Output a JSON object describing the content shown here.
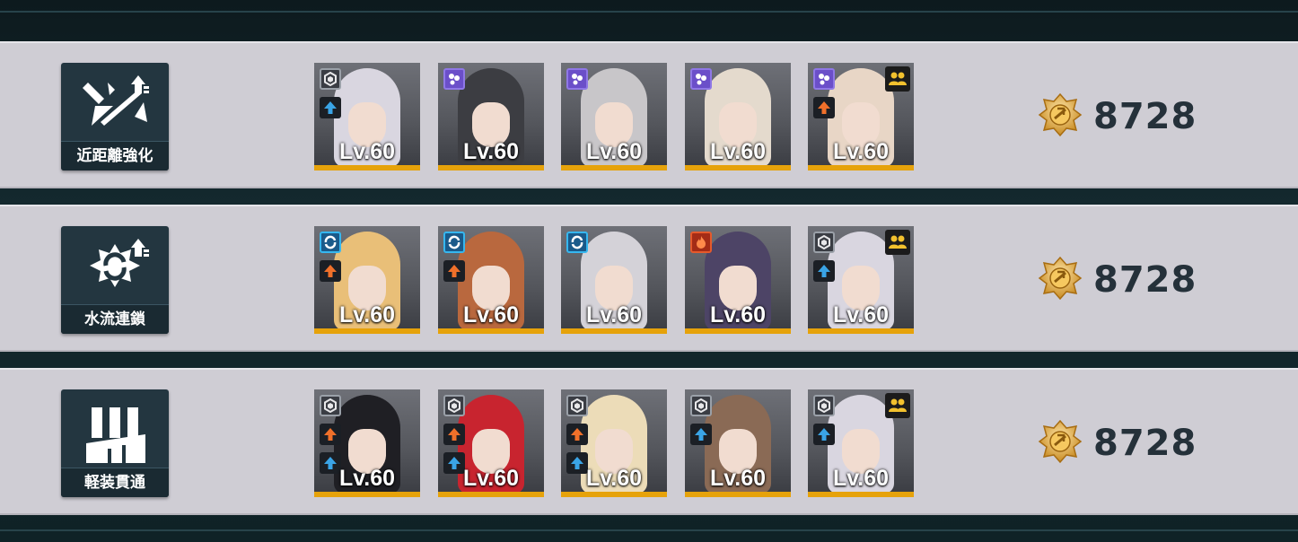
{
  "rows": [
    {
      "skill": {
        "label": "近距離強化",
        "icon": "melee-boost-icon"
      },
      "score": "8728",
      "cards": [
        {
          "level": "Lv.60",
          "role_icon": "hexagon-role-icon",
          "role_style": "generic",
          "stat_icon": "arrow-up-blue-icon",
          "hair": "#d9d6e0",
          "squad": false
        },
        {
          "level": "Lv.60",
          "role_icon": "dots-role-icon",
          "role_style": "purple",
          "stat_icon": "",
          "hair": "#3c3d42",
          "squad": false
        },
        {
          "level": "Lv.60",
          "role_icon": "dots-role-icon",
          "role_style": "purple",
          "stat_icon": "",
          "hair": "#c8c6c9",
          "squad": false
        },
        {
          "level": "Lv.60",
          "role_icon": "dots-role-icon",
          "role_style": "purple",
          "stat_icon": "",
          "hair": "#e4dacd",
          "squad": false
        },
        {
          "level": "Lv.60",
          "role_icon": "dots-role-icon",
          "role_style": "purple",
          "stat_icon": "arrow-up-orange-icon",
          "hair": "#e8d6c6",
          "squad": true
        }
      ]
    },
    {
      "skill": {
        "label": "水流連鎖",
        "icon": "water-chain-icon"
      },
      "score": "8728",
      "cards": [
        {
          "level": "Lv.60",
          "role_icon": "swirl-role-icon",
          "role_style": "cyan",
          "stat_icon": "arrow-up-orange-icon",
          "hair": "#e9bf78",
          "squad": false
        },
        {
          "level": "Lv.60",
          "role_icon": "swirl-role-icon",
          "role_style": "cyan",
          "stat_icon": "arrow-up-orange-icon",
          "hair": "#b9683e",
          "squad": false
        },
        {
          "level": "Lv.60",
          "role_icon": "swirl-role-icon",
          "role_style": "cyan",
          "stat_icon": "",
          "hair": "#d4d2d8",
          "squad": false
        },
        {
          "level": "Lv.60",
          "role_icon": "flame-role-icon",
          "role_style": "fire",
          "stat_icon": "",
          "hair": "#4d4466",
          "squad": false
        },
        {
          "level": "Lv.60",
          "role_icon": "hexagon-role-icon",
          "role_style": "generic",
          "stat_icon": "arrow-up-blue-icon",
          "hair": "#d9d6e0",
          "squad": true
        }
      ]
    },
    {
      "skill": {
        "label": "軽装貫通",
        "icon": "light-armor-pierce-icon"
      },
      "score": "8728",
      "cards": [
        {
          "level": "Lv.60",
          "role_icon": "hexagon-role-icon",
          "role_style": "generic",
          "stat_icon": "arrow-up-orange-icon",
          "stat_icon2": "arrow-up-blue-icon",
          "hair": "#1f1f24",
          "squad": false
        },
        {
          "level": "Lv.60",
          "role_icon": "hexagon-role-icon",
          "role_style": "generic",
          "stat_icon": "arrow-up-orange-icon",
          "stat_icon2": "arrow-up-blue-icon",
          "hair": "#c8242f",
          "squad": false
        },
        {
          "level": "Lv.60",
          "role_icon": "hexagon-role-icon",
          "role_style": "generic",
          "stat_icon": "arrow-up-orange-icon",
          "stat_icon2": "arrow-up-blue-icon",
          "hair": "#ecdcb8",
          "squad": false
        },
        {
          "level": "Lv.60",
          "role_icon": "hexagon-role-icon",
          "role_style": "generic",
          "stat_icon": "arrow-up-blue-icon",
          "hair": "#8a6a55",
          "squad": false
        },
        {
          "level": "Lv.60",
          "role_icon": "hexagon-role-icon",
          "role_style": "generic",
          "stat_icon": "arrow-up-blue-icon",
          "hair": "#d9d6e0",
          "squad": true
        }
      ]
    }
  ],
  "score_icon": "gold-medal-icon",
  "squad_icon": "squad-members-icon",
  "colors": {
    "level_bar": "#e6a20a",
    "orange_arrow": "#f0702a",
    "blue_arrow": "#3aa4e6",
    "squad_yellow": "#f2c12e"
  }
}
